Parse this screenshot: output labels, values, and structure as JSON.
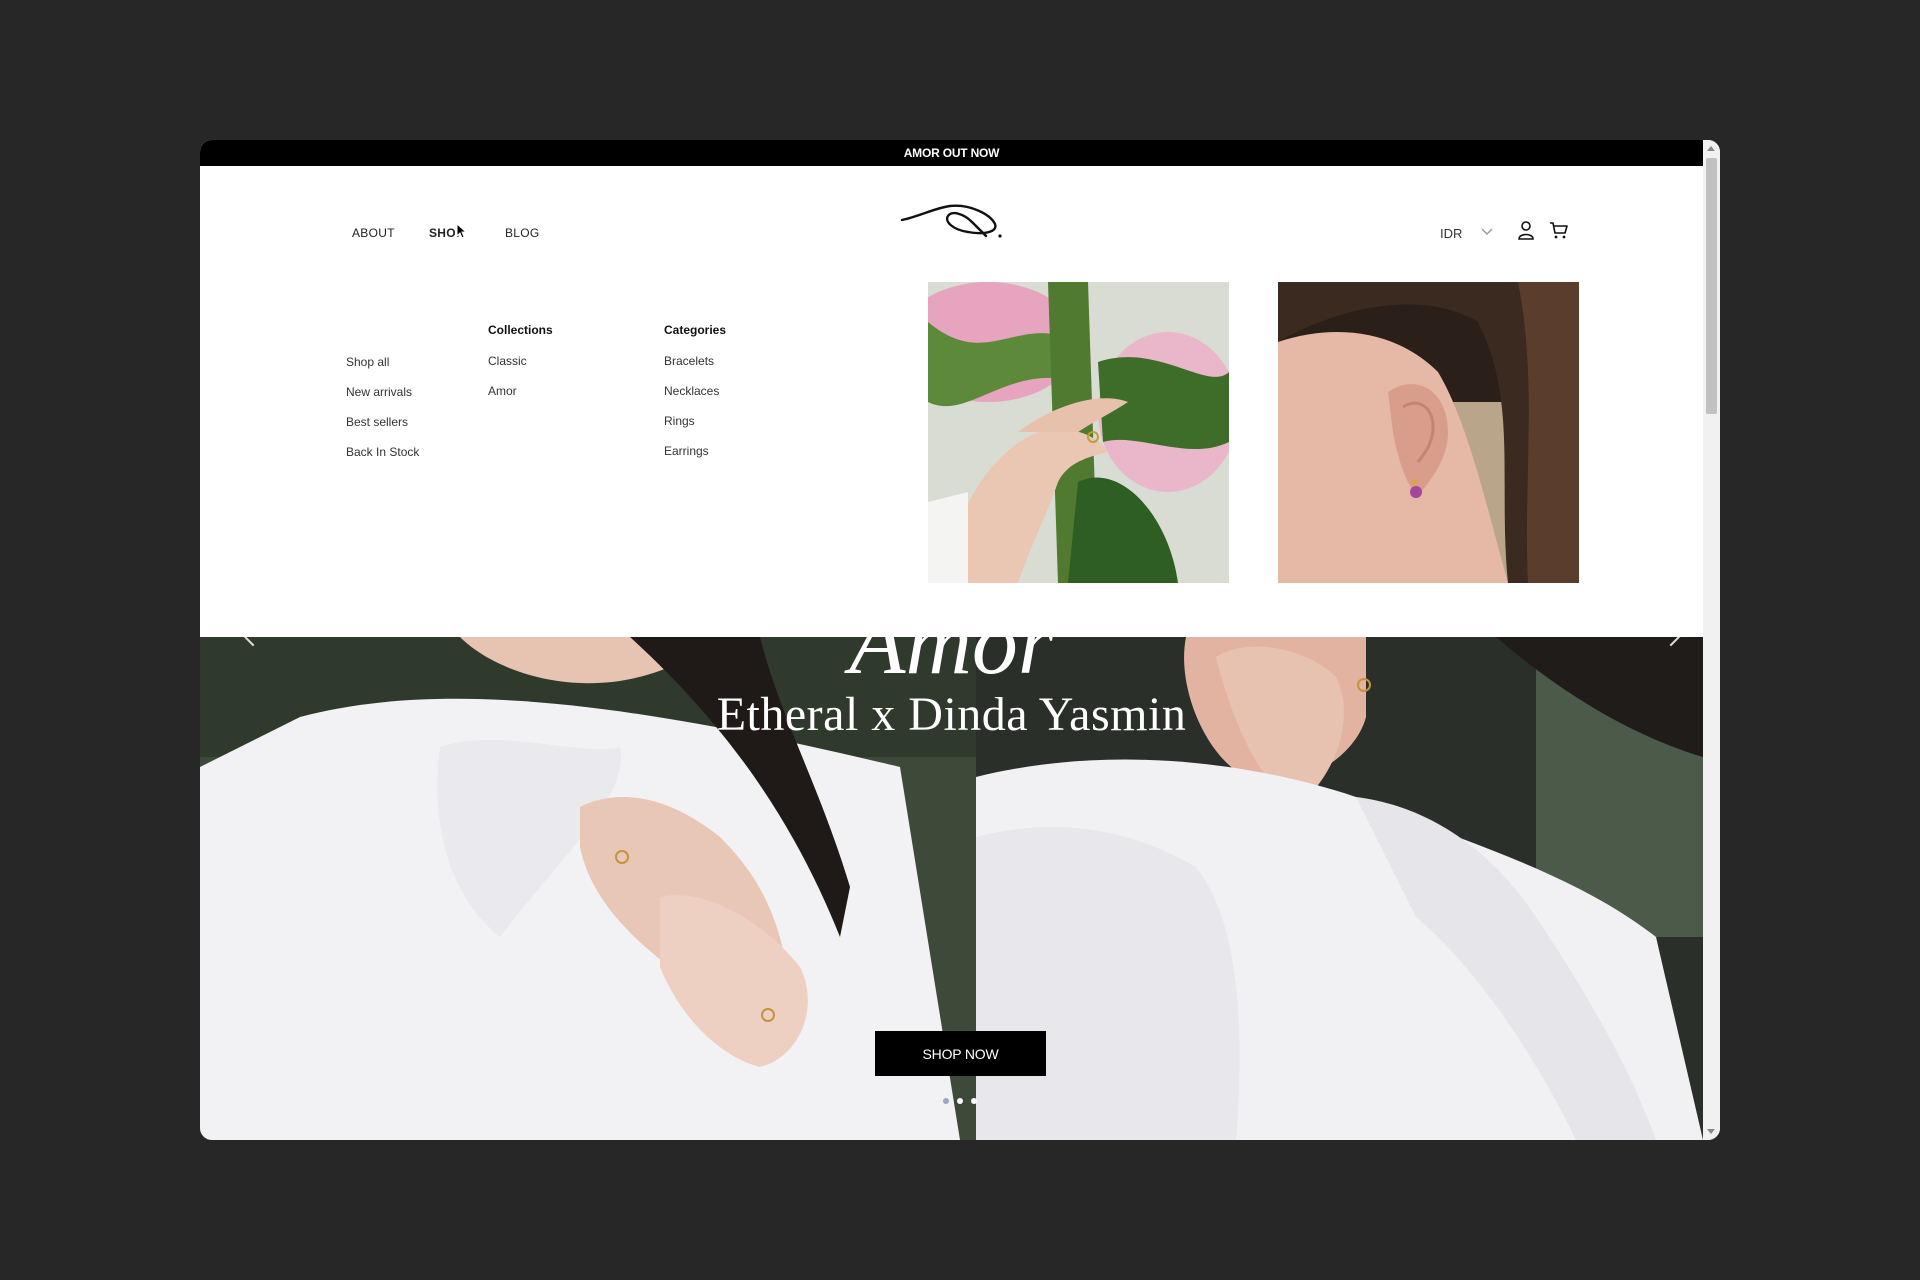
{
  "announcement": "AMOR OUT NOW",
  "nav": {
    "about": "ABOUT",
    "shop": "SHOP",
    "blog": "BLOG"
  },
  "header": {
    "currency": "IDR"
  },
  "menu": {
    "featured": [
      "Shop all",
      "New arrivals",
      "Best sellers",
      "Back In Stock"
    ],
    "collections": {
      "title": "Collections",
      "items": [
        "Classic",
        "Amor"
      ]
    },
    "categories": {
      "title": "Categories",
      "items": [
        "Bracelets",
        "Necklaces",
        "Rings",
        "Earrings"
      ]
    }
  },
  "hero": {
    "title_fragment": "Amor",
    "subtitle": "Etheral x Dinda Yasmin",
    "cta": "SHOP NOW",
    "slides": 3,
    "active_slide": 1
  },
  "icons": [
    "chevron-down-icon",
    "account-icon",
    "cart-icon",
    "chevron-left-icon",
    "chevron-right-icon"
  ],
  "colors": {
    "announcement_bg": "#000000",
    "button_bg": "#000000",
    "active_dot": "#9aa6c4"
  }
}
